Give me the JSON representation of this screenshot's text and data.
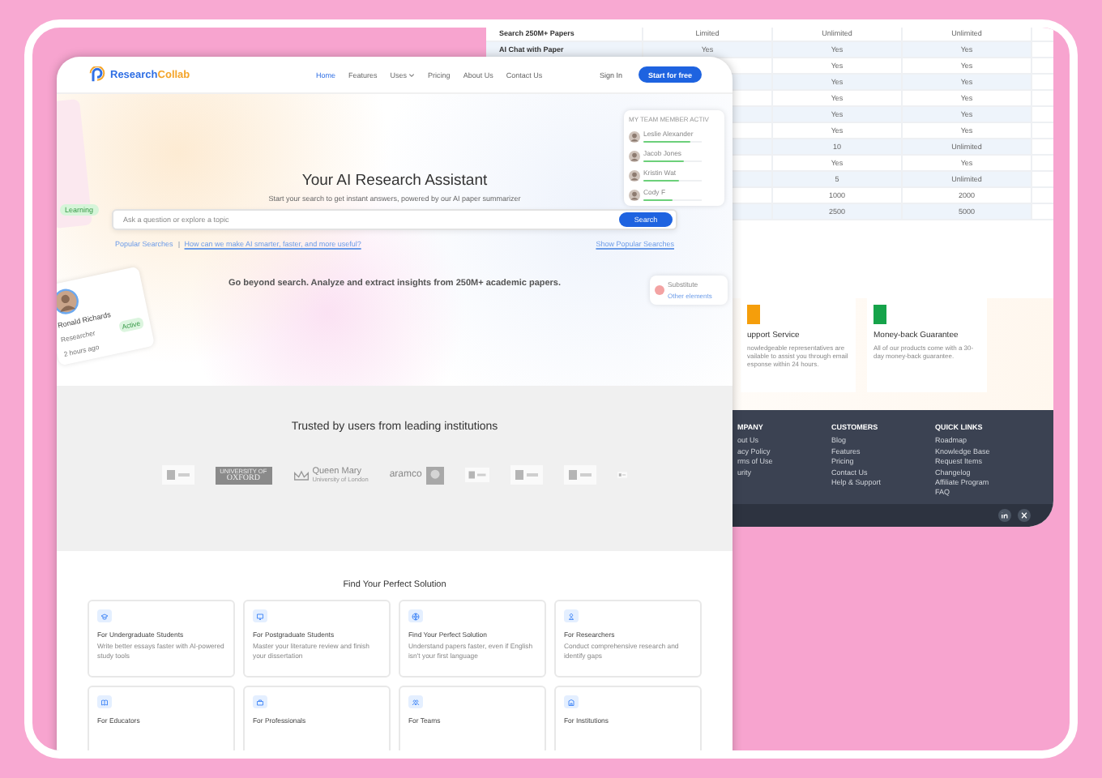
{
  "back_page": {
    "table": {
      "rows": [
        {
          "feature": "Search 250M+ Papers",
          "cells": [
            "Limited",
            "Unlimited",
            "Unlimited"
          ]
        },
        {
          "feature": "AI Chat with Paper",
          "cells": [
            "Yes",
            "Yes",
            "Yes"
          ]
        },
        {
          "cells": [
            "Yes",
            "Yes"
          ]
        },
        {
          "cells": [
            "Yes",
            "Yes"
          ]
        },
        {
          "cells": [
            "Yes",
            "Yes"
          ]
        },
        {
          "cells": [
            "Yes",
            "Yes"
          ]
        },
        {
          "cells": [
            "Yes",
            "Yes"
          ]
        },
        {
          "cells": [
            "10",
            "Unlimited"
          ]
        },
        {
          "cells": [
            "Yes",
            "Yes"
          ]
        },
        {
          "cells": [
            "5",
            "Unlimited"
          ]
        },
        {
          "cells": [
            "1000",
            "2000"
          ]
        },
        {
          "cells": [
            "2500",
            "5000"
          ]
        }
      ]
    },
    "features": [
      {
        "title": "upport Service",
        "text": "nowledgeable representatives are vailable to assist you through email esponse within 24 hours.",
        "color": "#f59e0b"
      },
      {
        "title": "Money-back Guarantee",
        "text": "All of our products come with a 30-day money-back guarantee.",
        "color": "#16a34a"
      }
    ],
    "footer": {
      "columns": [
        {
          "title": "MPANY",
          "links": [
            "out Us",
            "acy Policy",
            "rms of Use",
            "urity"
          ]
        },
        {
          "title": "CUSTOMERS",
          "links": [
            "Blog",
            "Features",
            "Pricing",
            "Contact Us",
            "Help & Support"
          ]
        },
        {
          "title": "QUICK LINKS",
          "links": [
            "Roadmap",
            "Knowledge Base",
            "Request Items",
            "Changelog",
            "Affiliate Program",
            "FAQ"
          ]
        }
      ]
    }
  },
  "front_page": {
    "brand": {
      "primary": "Research",
      "accent": "Collab"
    },
    "nav": [
      {
        "label": "Home",
        "selected": true
      },
      {
        "label": "Features",
        "selected": false
      },
      {
        "label": "Uses",
        "selected": false,
        "dropdown": true
      },
      {
        "label": "Pricing",
        "selected": false
      },
      {
        "label": "About Us",
        "selected": false
      },
      {
        "label": "Contact Us",
        "selected": false
      }
    ],
    "sign_in": "Sign In",
    "cta": "Start for free",
    "hero": {
      "title": "Your AI Research Assistant",
      "subtitle": "Start your search to get instant answers, powered by our AI paper summarizer",
      "search": {
        "placeholder": "Ask a question or explore a topic",
        "button": "Search"
      },
      "popular_label": "Popular Searches",
      "popular_link": "How can we make AI smarter, faster, and more useful?",
      "show_popular": "Show Popular Searches",
      "tagline": "Go beyond search. Analyze and extract insights from 250M+ academic papers.",
      "learning_pill": "Learning",
      "profile": {
        "name": "Ronald Richards",
        "role": "Researcher",
        "status": "Active",
        "time": "2 hours ago"
      },
      "team": {
        "title": "MY TEAM MEMBER ACTIV",
        "members": [
          {
            "name": "Leslie Alexander",
            "level": 0.8
          },
          {
            "name": "Jacob Jones",
            "level": 0.7
          },
          {
            "name": "Kristin Wat",
            "level": 0.6
          },
          {
            "name": "Cody F",
            "level": 0.5
          }
        ]
      },
      "note": {
        "title": "Substitute",
        "link": "Other elements"
      }
    },
    "trusted": {
      "title": "Trusted by users from leading institutions",
      "logos": [
        {
          "kind": "mark"
        },
        {
          "kind": "boxed",
          "lines": [
            "UNIVERSITY OF",
            "OXFORD"
          ]
        },
        {
          "kind": "crest",
          "lines": [
            "Queen Mary",
            "University of London"
          ]
        },
        {
          "kind": "wordmark",
          "lines": [
            "aramco"
          ]
        },
        {
          "kind": "mark"
        },
        {
          "kind": "mark"
        },
        {
          "kind": "mark"
        },
        {
          "kind": "mark"
        }
      ]
    },
    "solutions": {
      "title": "Find Your Perfect Solution",
      "cards": [
        {
          "title": "For Undergraduate Students",
          "text": "Write better essays faster with AI-powered study tools"
        },
        {
          "title": "For Postgraduate Students",
          "text": "Master your literature review and finish your dissertation"
        },
        {
          "title": "Find Your Perfect Solution",
          "text": "Understand papers faster, even if English isn't your first language"
        },
        {
          "title": "For Researchers",
          "text": "Conduct comprehensive research and identify gaps"
        },
        {
          "title": "For Educators"
        },
        {
          "title": "For Professionals"
        },
        {
          "title": "For Teams"
        },
        {
          "title": "For Institutions"
        }
      ]
    }
  }
}
